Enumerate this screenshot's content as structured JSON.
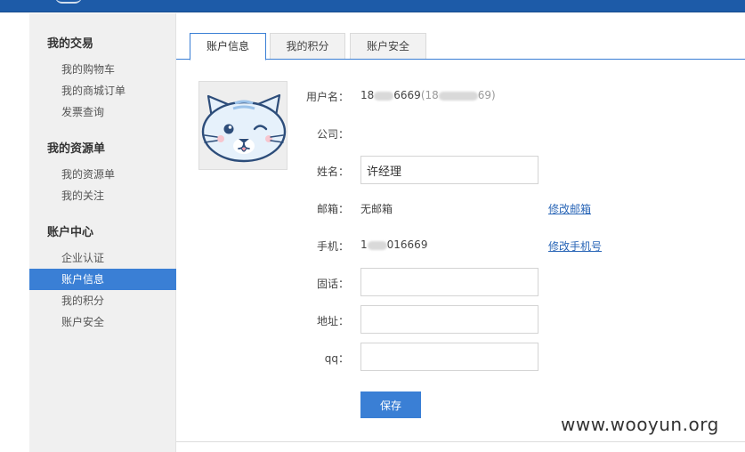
{
  "sidebar": {
    "groups": [
      {
        "title": "我的交易",
        "items": [
          "我的购物车",
          "我的商城订单",
          "发票查询"
        ]
      },
      {
        "title": "我的资源单",
        "items": [
          "我的资源单",
          "我的关注"
        ]
      },
      {
        "title": "账户中心",
        "items": [
          "企业认证",
          "账户信息",
          "我的积分",
          "账户安全"
        ]
      }
    ],
    "active_item": "账户信息"
  },
  "tabs": [
    "账户信息",
    "我的积分",
    "账户安全"
  ],
  "active_tab": "账户信息",
  "form": {
    "username_label": "用户名：",
    "username_prefix": "18",
    "username_suffix": "6669",
    "username_paren_open": "(18",
    "username_paren_close": "69)",
    "company_label": "公司：",
    "name_label": "姓名：",
    "name_value": "许经理",
    "email_label": "邮箱：",
    "email_value": "无邮箱",
    "email_link": "修改邮箱",
    "phone_label": "手机：",
    "phone_prefix": "1",
    "phone_suffix": "016669",
    "phone_link": "修改手机号",
    "landline_label": "固话：",
    "landline_value": "",
    "address_label": "地址：",
    "address_value": "",
    "qq_label": "qq：",
    "qq_value": "",
    "save_label": "保存"
  },
  "watermark": "www.wooyun.org",
  "colors": {
    "header": "#1d5ba8",
    "accent": "#3a7fd5",
    "link": "#2a66b7"
  },
  "icons": {
    "avatar": "cat-face-icon"
  }
}
